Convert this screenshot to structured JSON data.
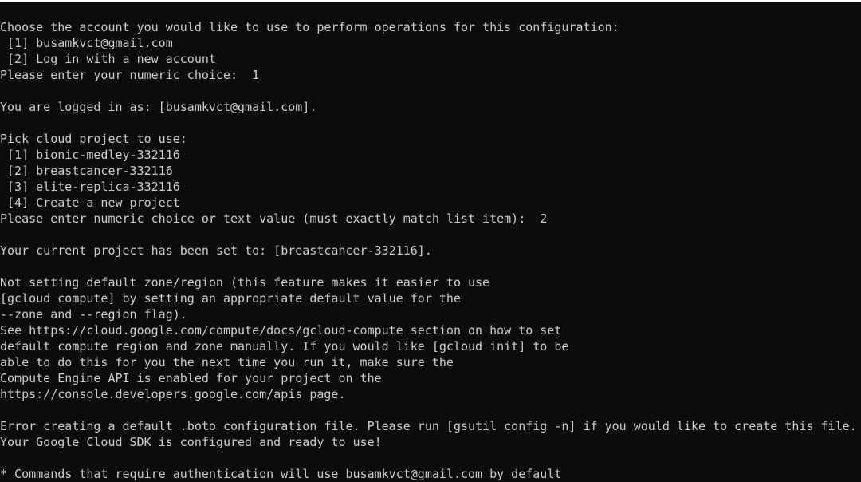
{
  "terminal": {
    "lines": [
      "Choose the account you would like to use to perform operations for this configuration:",
      " [1] busamkvct@gmail.com",
      " [2] Log in with a new account",
      "Please enter your numeric choice:  1",
      "",
      "You are logged in as: [busamkvct@gmail.com].",
      "",
      "Pick cloud project to use:",
      " [1] bionic-medley-332116",
      " [2] breastcancer-332116",
      " [3] elite-replica-332116",
      " [4] Create a new project",
      "Please enter numeric choice or text value (must exactly match list item):  2",
      "",
      "Your current project has been set to: [breastcancer-332116].",
      "",
      "Not setting default zone/region (this feature makes it easier to use",
      "[gcloud compute] by setting an appropriate default value for the",
      "--zone and --region flag).",
      "See https://cloud.google.com/compute/docs/gcloud-compute section on how to set",
      "default compute region and zone manually. If you would like [gcloud init] to be",
      "able to do this for you the next time you run it, make sure the",
      "Compute Engine API is enabled for your project on the",
      "https://console.developers.google.com/apis page.",
      "",
      "Error creating a default .boto configuration file. Please run [gsutil config -n] if you would like to create this file.",
      "Your Google Cloud SDK is configured and ready to use!",
      "",
      "* Commands that require authentication will use busamkvct@gmail.com by default"
    ]
  },
  "colors": {
    "background": "#0c0c0c",
    "foreground": "#cccccc"
  }
}
